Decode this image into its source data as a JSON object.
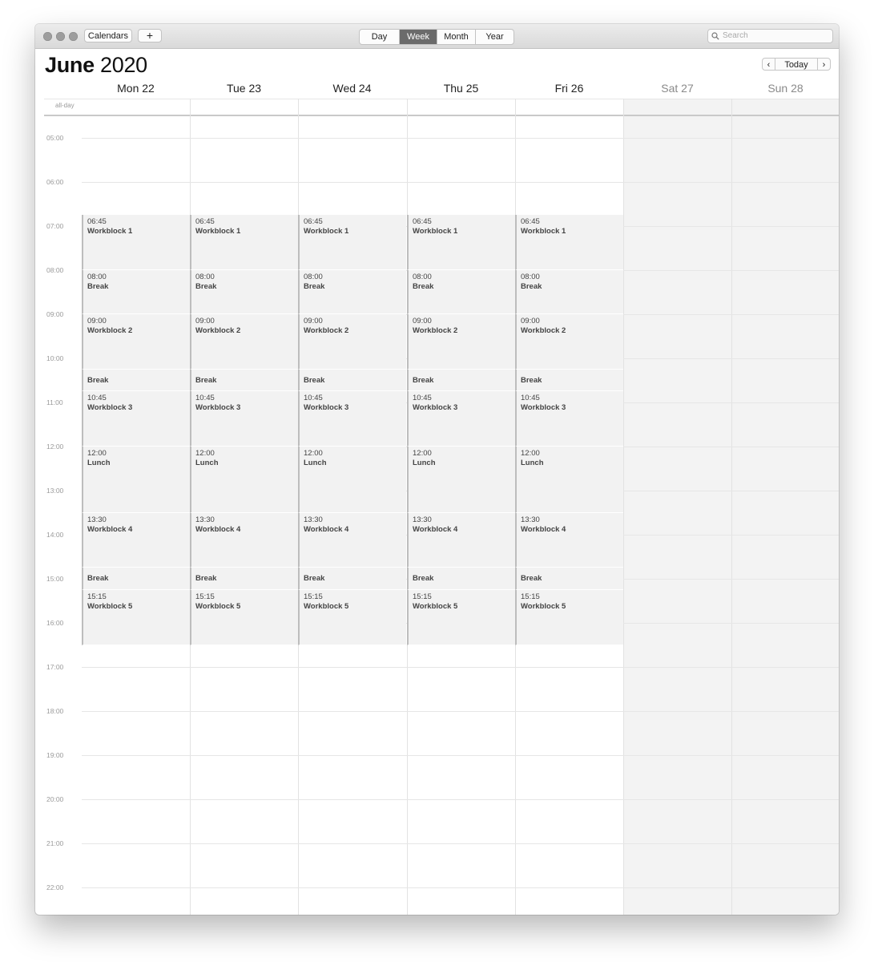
{
  "toolbar": {
    "calendars_label": "Calendars",
    "add_label": "+",
    "views": [
      "Day",
      "Week",
      "Month",
      "Year"
    ],
    "active_view": "Week",
    "search_placeholder": "Search"
  },
  "header": {
    "month": "June",
    "year": "2020",
    "today_label": "Today",
    "prev_symbol": "‹",
    "next_symbol": "›"
  },
  "allday_label": "all-day",
  "days": [
    {
      "label": "Mon 22",
      "weekend": false
    },
    {
      "label": "Tue 23",
      "weekend": false
    },
    {
      "label": "Wed 24",
      "weekend": false
    },
    {
      "label": "Thu 25",
      "weekend": false
    },
    {
      "label": "Fri 26",
      "weekend": false
    },
    {
      "label": "Sat 27",
      "weekend": true
    },
    {
      "label": "Sun 28",
      "weekend": true
    }
  ],
  "hours": [
    "05:00",
    "06:00",
    "07:00",
    "08:00",
    "09:00",
    "10:00",
    "11:00",
    "12:00",
    "13:00",
    "14:00",
    "15:00",
    "16:00",
    "17:00",
    "18:00",
    "19:00",
    "20:00",
    "21:00",
    "22:00"
  ],
  "weekday_events": [
    {
      "time": "06:45",
      "title": "Workblock 1",
      "start": "06:45",
      "end": "08:00"
    },
    {
      "time": "08:00",
      "title": "Break",
      "start": "08:00",
      "end": "09:00"
    },
    {
      "time": "09:00",
      "title": "Workblock 2",
      "start": "09:00",
      "end": "10:15"
    },
    {
      "time": "",
      "title": "Break",
      "start": "10:15",
      "end": "10:45"
    },
    {
      "time": "10:45",
      "title": "Workblock 3",
      "start": "10:45",
      "end": "12:00"
    },
    {
      "time": "12:00",
      "title": "Lunch",
      "start": "12:00",
      "end": "13:30"
    },
    {
      "time": "13:30",
      "title": "Workblock 4",
      "start": "13:30",
      "end": "14:45"
    },
    {
      "time": "",
      "title": "Break",
      "start": "14:45",
      "end": "15:15"
    },
    {
      "time": "15:15",
      "title": "Workblock 5",
      "start": "15:15",
      "end": "16:30"
    }
  ],
  "colors": {
    "active_segment": "#6b6b6b",
    "event_bg": "#f2f2f2",
    "event_border": "#bdbdbd",
    "weekend_bg": "#f3f3f3"
  }
}
